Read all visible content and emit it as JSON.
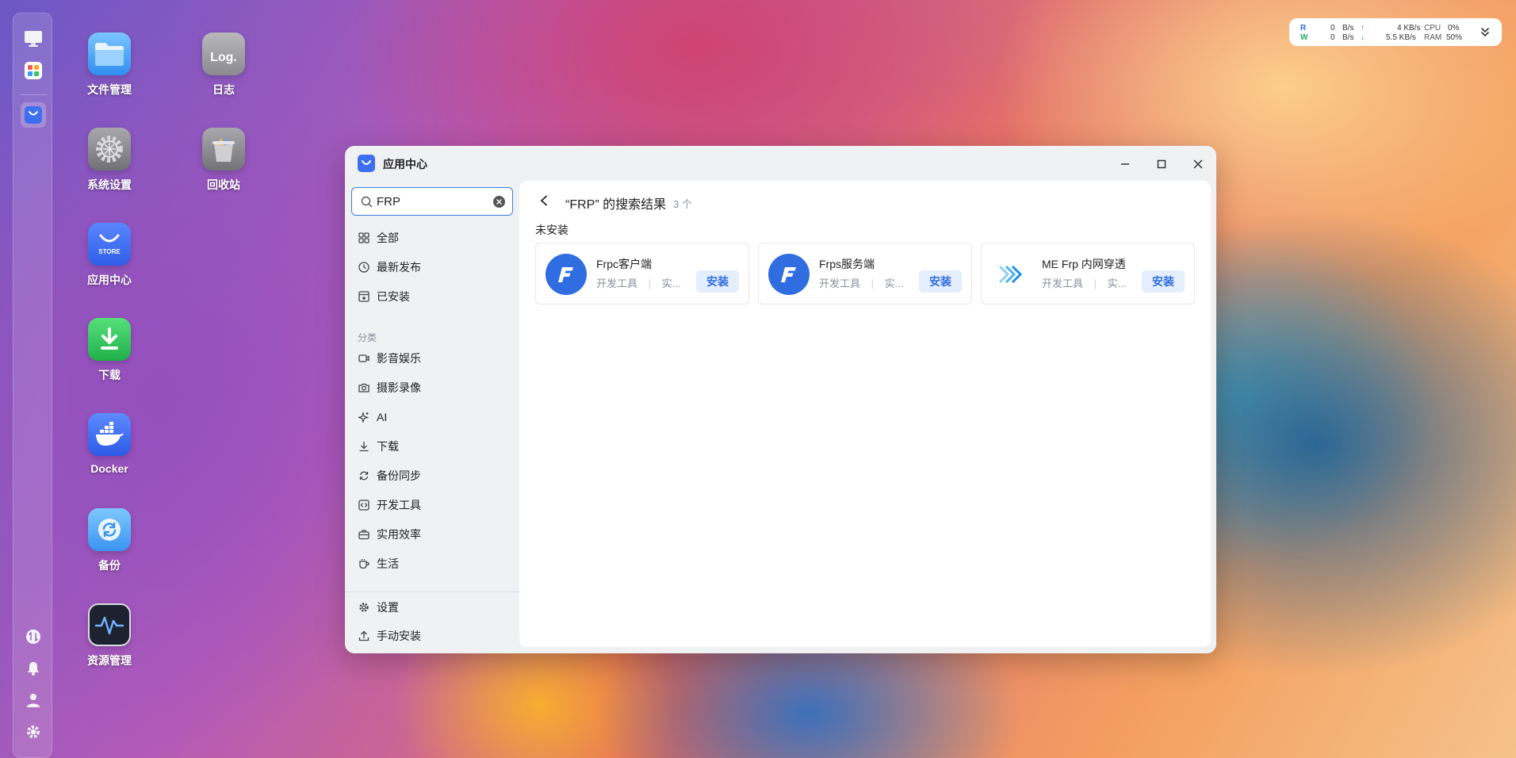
{
  "dock": {
    "items": [
      "desktop-icon",
      "app-grid-icon",
      "app-center-icon"
    ],
    "bottom_items": [
      "transfer-icon",
      "bell-icon",
      "user-icon",
      "gear-icon"
    ]
  },
  "desktop": {
    "icons": [
      {
        "label": "文件管理",
        "icon": "folder-icon"
      },
      {
        "label": "日志",
        "icon": "log-icon",
        "badge": "Log."
      },
      {
        "label": "系统设置",
        "icon": "gear-icon"
      },
      {
        "label": "回收站",
        "icon": "trash-icon"
      },
      {
        "label": "应用中心",
        "icon": "store-icon",
        "badge": "STORE"
      },
      {
        "label": "下载",
        "icon": "download-icon"
      },
      {
        "label": "Docker",
        "icon": "docker-icon"
      },
      {
        "label": "备份",
        "icon": "backup-icon"
      },
      {
        "label": "资源管理",
        "icon": "activity-icon"
      }
    ]
  },
  "monitor": {
    "read_label": "R",
    "write_label": "W",
    "read_value": "0",
    "write_value": "0",
    "unit": "B/s",
    "upload": "4 KB/s",
    "download": "5.5 KB/s",
    "cpu_label": "CPU",
    "ram_label": "RAM",
    "cpu_value": "0%",
    "ram_value": "50%",
    "accent": "#2f6de1"
  },
  "window": {
    "title": "应用中心",
    "search": {
      "value": "FRP",
      "placeholder": ""
    },
    "nav": [
      {
        "label": "全部",
        "icon": "grid-icon"
      },
      {
        "label": "最新发布",
        "icon": "clock-icon"
      },
      {
        "label": "已安装",
        "icon": "installed-icon"
      }
    ],
    "category_heading": "分类",
    "categories": [
      {
        "label": "影音娱乐",
        "icon": "video-icon"
      },
      {
        "label": "摄影录像",
        "icon": "camera-icon"
      },
      {
        "label": "AI",
        "icon": "sparkle-icon"
      },
      {
        "label": "下载",
        "icon": "download-icon"
      },
      {
        "label": "备份同步",
        "icon": "sync-icon"
      },
      {
        "label": "开发工具",
        "icon": "code-icon"
      },
      {
        "label": "实用效率",
        "icon": "toolbox-icon"
      },
      {
        "label": "生活",
        "icon": "cup-icon"
      }
    ],
    "footer": [
      {
        "label": "设置",
        "icon": "gear-icon"
      },
      {
        "label": "手动安装",
        "icon": "upload-icon"
      }
    ],
    "results": {
      "title": "“FRP” 的搜索结果",
      "count": "3 个",
      "section": "未安装",
      "apps": [
        {
          "name": "Frpc客户端",
          "tag1": "开发工具",
          "tag2": "实...",
          "action": "安装",
          "logo": "frp-logo"
        },
        {
          "name": "Frps服务端",
          "tag1": "开发工具",
          "tag2": "实...",
          "action": "安装",
          "logo": "frp-logo"
        },
        {
          "name": "ME Frp 内网穿透",
          "tag1": "开发工具",
          "tag2": "实...",
          "action": "安装",
          "logo": "mefrp-logo"
        }
      ]
    }
  }
}
